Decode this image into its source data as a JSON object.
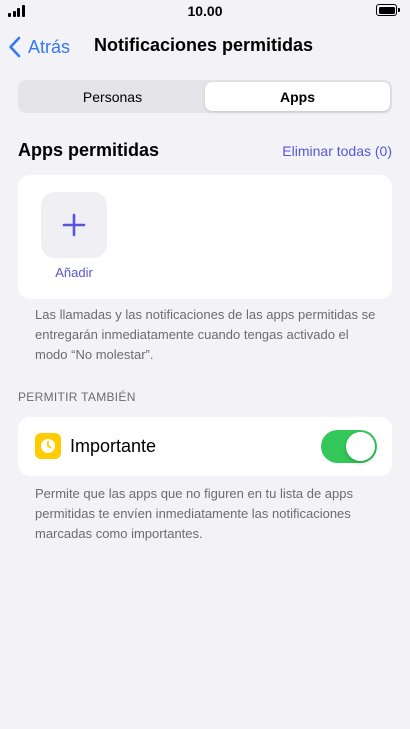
{
  "status_bar": {
    "time": "10.00"
  },
  "nav": {
    "back_label": "Atrás",
    "title": "Notificaciones permitidas"
  },
  "segments": [
    {
      "label": "Personas",
      "selected": false
    },
    {
      "label": "Apps",
      "selected": true
    }
  ],
  "apps_section": {
    "title": "Apps permitidas",
    "remove_all_label": "Eliminar todas (0)",
    "add_label": "Añadir",
    "footnote": "Las llamadas y las notificaciones de las apps permitidas se entregarán inmediatamente cuando tengas activado el modo “No molestar”."
  },
  "allow_also": {
    "header": "PERMITIR TAMBIÉN",
    "important_label": "Importante",
    "important_enabled": true,
    "footnote": "Permite que las apps que no figuren en tu lista de apps permitidas te envíen inmediatamente las notificaciones marcadas como importantes."
  },
  "colors": {
    "accent": "#5856d6",
    "link_blue": "#3478f6",
    "toggle_on": "#34c759",
    "important_icon_bg": "#ffcc00"
  }
}
